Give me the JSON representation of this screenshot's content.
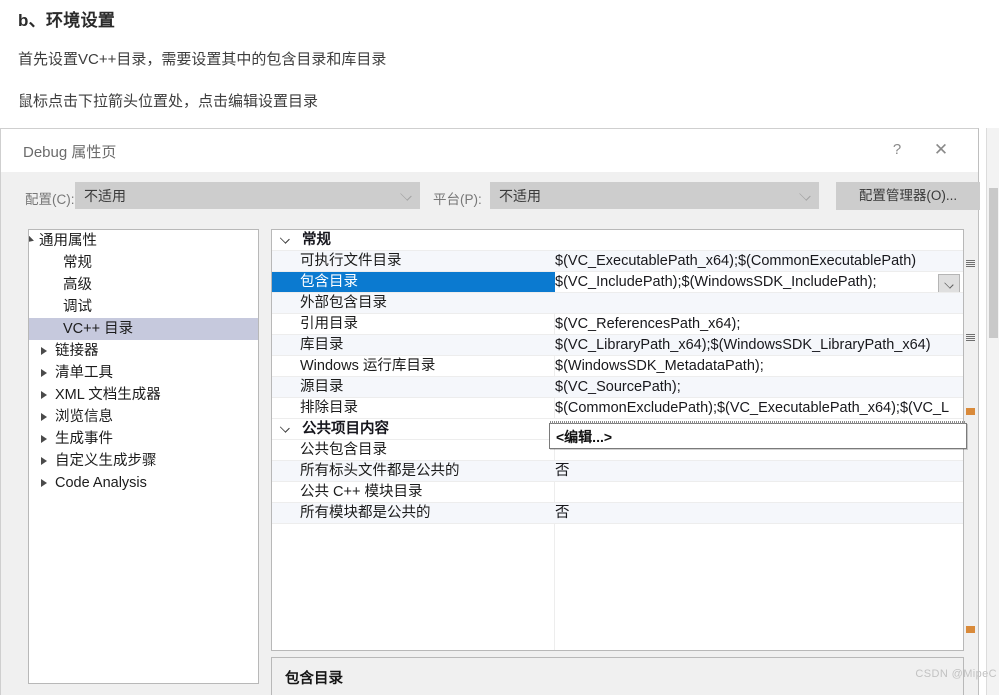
{
  "article": {
    "heading": "b、环境设置",
    "paragraph1": "首先设置VC++目录，需要设置其中的包含目录和库目录",
    "paragraph2": "鼠标点击下拉箭头位置处，点击编辑设置目录"
  },
  "dialog": {
    "title": "Debug 属性页",
    "help_label": "?",
    "close_label": "✕",
    "configbar": {
      "config_label": "配置(C):",
      "config_value": "不适用",
      "platform_label": "平台(P):",
      "platform_value": "不适用",
      "config_manager_button": "配置管理器(O)..."
    },
    "tree": [
      {
        "label": "通用属性",
        "indent": 10,
        "twisty": "expanded",
        "selected": false
      },
      {
        "label": "常规",
        "indent": 34,
        "twisty": "none",
        "selected": false
      },
      {
        "label": "高级",
        "indent": 34,
        "twisty": "none",
        "selected": false
      },
      {
        "label": "调试",
        "indent": 34,
        "twisty": "none",
        "selected": false
      },
      {
        "label": "VC++ 目录",
        "indent": 34,
        "twisty": "none",
        "selected": true
      },
      {
        "label": "链接器",
        "indent": 26,
        "twisty": "collapsed",
        "selected": false
      },
      {
        "label": "清单工具",
        "indent": 26,
        "twisty": "collapsed",
        "selected": false
      },
      {
        "label": "XML 文档生成器",
        "indent": 26,
        "twisty": "collapsed",
        "selected": false
      },
      {
        "label": "浏览信息",
        "indent": 26,
        "twisty": "collapsed",
        "selected": false
      },
      {
        "label": "生成事件",
        "indent": 26,
        "twisty": "collapsed",
        "selected": false
      },
      {
        "label": "自定义生成步骤",
        "indent": 26,
        "twisty": "collapsed",
        "selected": false
      },
      {
        "label": "Code Analysis",
        "indent": 26,
        "twisty": "collapsed",
        "selected": false
      }
    ],
    "grid": [
      {
        "kind": "category",
        "name": "常规",
        "value": ""
      },
      {
        "kind": "prop",
        "name": "可执行文件目录",
        "value": "$(VC_ExecutablePath_x64);$(CommonExecutablePath)"
      },
      {
        "kind": "prop",
        "name": "包含目录",
        "value": "$(VC_IncludePath);$(WindowsSDK_IncludePath);",
        "selected": true,
        "has_dropdown": true
      },
      {
        "kind": "prop",
        "name": "外部包含目录",
        "value": ""
      },
      {
        "kind": "prop",
        "name": "引用目录",
        "value": "$(VC_ReferencesPath_x64);"
      },
      {
        "kind": "prop",
        "name": "库目录",
        "value": "$(VC_LibraryPath_x64);$(WindowsSDK_LibraryPath_x64)"
      },
      {
        "kind": "prop",
        "name": "Windows 运行库目录",
        "value": "$(WindowsSDK_MetadataPath);"
      },
      {
        "kind": "prop",
        "name": "源目录",
        "value": "$(VC_SourcePath);"
      },
      {
        "kind": "prop",
        "name": "排除目录",
        "value": "$(CommonExcludePath);$(VC_ExecutablePath_x64);$(VC_L"
      },
      {
        "kind": "category",
        "name": "公共项目内容",
        "value": ""
      },
      {
        "kind": "prop",
        "name": "公共包含目录",
        "value": ""
      },
      {
        "kind": "prop",
        "name": "所有标头文件都是公共的",
        "value": "否"
      },
      {
        "kind": "prop",
        "name": "公共 C++ 模块目录",
        "value": ""
      },
      {
        "kind": "prop",
        "name": "所有模块都是公共的",
        "value": "否"
      }
    ],
    "dropdown_popup": {
      "item": "<编辑...>"
    },
    "description": {
      "title": "包含目录"
    }
  },
  "watermark": "CSDN @MipeC"
}
